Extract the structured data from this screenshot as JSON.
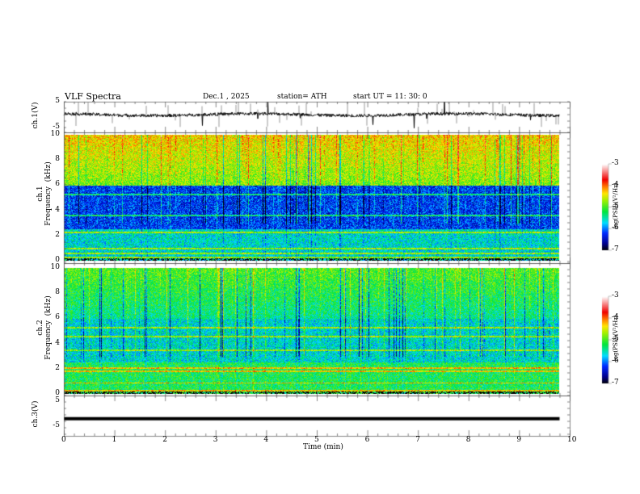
{
  "header": {
    "title": "VLF  Spectra",
    "date": "Dec.1  , 2025",
    "station": "station= ATH",
    "start": "start  UT  =    11: 30: 0"
  },
  "chart_data": [
    {
      "type": "line",
      "name": "ch1-waveform",
      "ylabel": "ch.1(V)",
      "ylim": [
        -5,
        5
      ],
      "yticks": [
        "5",
        "-5"
      ],
      "xlim": [
        0,
        10
      ],
      "data_xrange": [
        0,
        9.8
      ],
      "approximate_baseline": 0,
      "color": "#000000"
    },
    {
      "type": "heatmap",
      "name": "ch1-spectrogram",
      "ylabel": "ch.1\nFrequency  (kHz)",
      "ylim": [
        0,
        10
      ],
      "yticks": [
        "0",
        "2",
        "4",
        "6",
        "8",
        "10"
      ],
      "xlim": [
        0,
        10
      ],
      "colorbar": {
        "label": "log(PSD)(V²/Hz)",
        "range": [
          -7,
          -3
        ],
        "ticks": [
          "-3",
          "-4",
          "-5",
          "-6",
          "-7"
        ]
      },
      "approximate_features": {
        "high_band_level": -4.8,
        "mid_band_level": -6.2,
        "low_band_level": -5.6,
        "lines_kHz": [
          0.3,
          0.6,
          1.0,
          2.3,
          3.6,
          5.3
        ]
      }
    },
    {
      "type": "heatmap",
      "name": "ch2-spectrogram",
      "ylabel": "ch.2\nFrequency  (kHz)",
      "ylim": [
        0,
        10
      ],
      "yticks": [
        "0",
        "2",
        "4",
        "6",
        "8",
        "10"
      ],
      "xlim": [
        0,
        10
      ],
      "colorbar": {
        "label": "log(PSD)(V²/Hz)",
        "range": [
          -7,
          -3
        ],
        "ticks": [
          "-3",
          "-4",
          "-5",
          "-6",
          "-7"
        ]
      },
      "approximate_features": {
        "high_band_level": -5.4,
        "mid_band_level": -5.6,
        "low_band_level": -5.2,
        "lines_kHz": [
          0.3,
          0.9,
          1.8,
          2.1,
          3.5,
          4.6,
          5.3
        ]
      }
    },
    {
      "type": "line",
      "name": "ch3-waveform",
      "ylabel": "ch.3(V)",
      "ylim": [
        -5,
        5
      ],
      "yticks": [
        "5",
        "-5"
      ],
      "xlim": [
        0,
        10
      ],
      "data_xrange": [
        0,
        9.8
      ],
      "approximate_value": -2,
      "color": "#000000"
    }
  ],
  "xaxis": {
    "label": "Time  (min)",
    "ticks": [
      "0",
      "1",
      "2",
      "3",
      "4",
      "5",
      "6",
      "7",
      "8",
      "9",
      "10"
    ]
  }
}
